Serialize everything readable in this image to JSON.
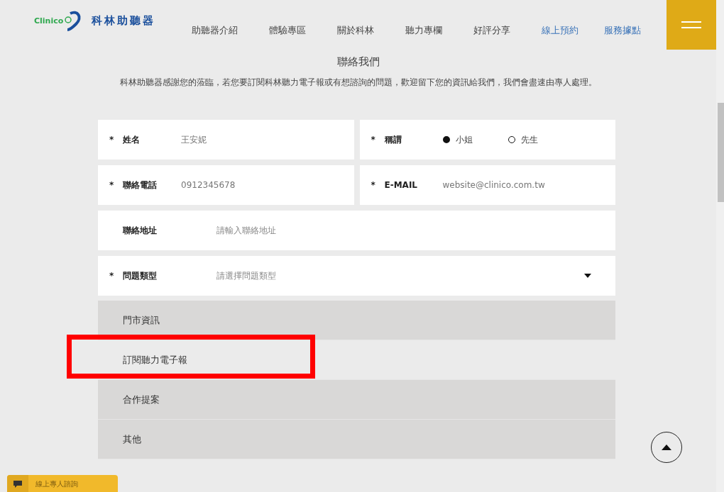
{
  "header": {
    "logo_text": "Clinico",
    "brand": "科林助聽器",
    "nav": [
      {
        "label": "助聽器介紹",
        "highlight": false
      },
      {
        "label": "體驗專區",
        "highlight": false
      },
      {
        "label": "關於科林",
        "highlight": false
      },
      {
        "label": "聽力專欄",
        "highlight": false
      },
      {
        "label": "好評分享",
        "highlight": false
      },
      {
        "label": "線上預約",
        "highlight": true
      },
      {
        "label": "服務據點",
        "highlight": true
      }
    ]
  },
  "title": "聯絡我們",
  "intro": "科林助聽器感謝您的蒞臨，若您要訂閱科林聽力電子報或有想諮詢的問題，歡迎留下您的資訊給我們，我們會盡速由專人處理。",
  "form": {
    "rows": [
      [
        {
          "kind": "text",
          "required_mark": "*",
          "label": "姓名",
          "value": "王安妮"
        },
        {
          "kind": "radio",
          "required_mark": "*",
          "label": "稱謂",
          "options": [
            {
              "label": "小姐",
              "selected": true
            },
            {
              "label": "先生",
              "selected": false
            }
          ]
        }
      ],
      [
        {
          "kind": "text",
          "required_mark": "*",
          "label": "聯絡電話",
          "value": "0912345678"
        },
        {
          "kind": "text",
          "required_mark": "*",
          "label": "E-MAIL",
          "value": "website@clinico.com.tw"
        }
      ],
      [
        {
          "kind": "wide",
          "label": "聯絡地址",
          "placeholder": "請輸入聯絡地址"
        }
      ],
      [
        {
          "kind": "select",
          "required_mark": "*",
          "label": "問題類型",
          "placeholder": "請選擇問題類型"
        }
      ]
    ],
    "dropdown": [
      {
        "label": "門市資訊",
        "selected": false,
        "marked": false
      },
      {
        "label": "訂閱聽力電子報",
        "selected": true,
        "marked": true
      },
      {
        "label": "合作提案",
        "selected": false,
        "marked": false
      },
      {
        "label": "其他",
        "selected": false,
        "marked": false
      }
    ]
  },
  "chat_button": "線上專人諮詢"
}
